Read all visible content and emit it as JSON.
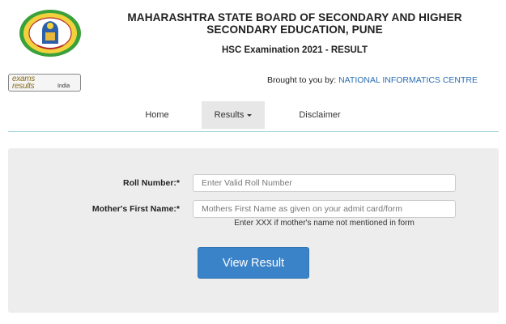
{
  "header": {
    "title_line1": "MAHARASHTRA STATE BOARD OF SECONDARY AND HIGHER",
    "title_line2": "SECONDARY EDUCATION, PUNE",
    "subtitle": "HSC Examination 2021 - RESULT"
  },
  "partner": {
    "logo_line1": "exams",
    "logo_line2": "results",
    "logo_line3": "India"
  },
  "credit": {
    "prefix": "Brought to you by: ",
    "org": "NATIONAL INFORMATICS CENTRE"
  },
  "nav": {
    "home": "Home",
    "results": "Results",
    "disclaimer": "Disclaimer"
  },
  "form": {
    "roll_label": "Roll Number:*",
    "roll_placeholder": "Enter Valid Roll Number",
    "mother_label": "Mother's First Name:*",
    "mother_placeholder": "Mothers First Name as given on your admit card/form",
    "hint": "Enter XXX if mother's name not mentioned in form",
    "submit_label": "View Result"
  },
  "colors": {
    "accent": "#3b83c8",
    "link": "#2a6db3",
    "panel": "#ededed",
    "nav_active": "#e7e7e7",
    "rule": "#9fd4dc"
  }
}
